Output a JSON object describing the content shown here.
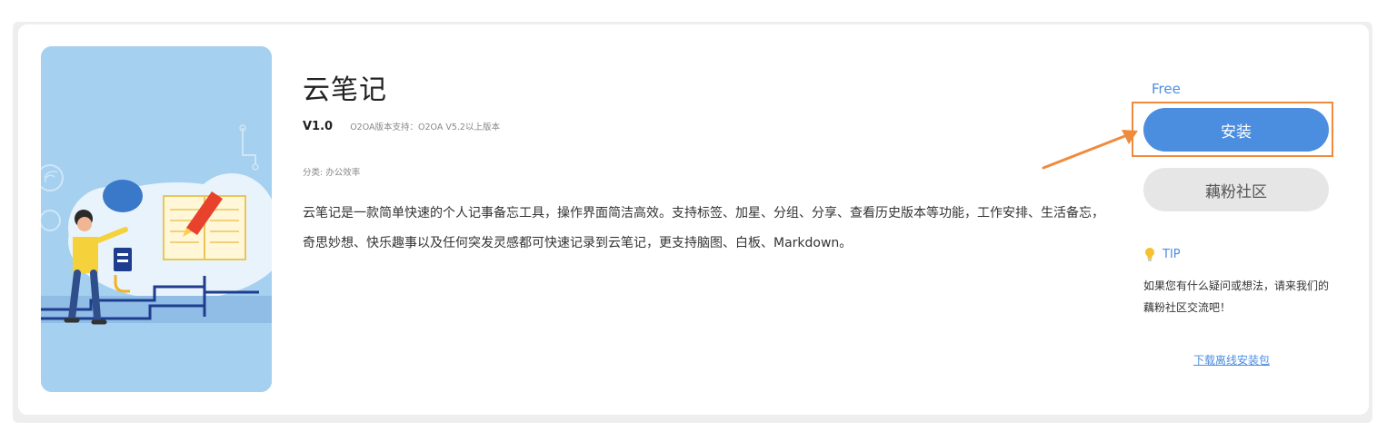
{
  "app": {
    "title": "云笔记",
    "version": "V1.0",
    "support": "O2OA版本支持：O2OA V5.2以上版本",
    "category": "分类: 办公效率",
    "description": "云笔记是一款简单快速的个人记事备忘工具，操作界面简洁高效。支持标签、加星、分组、分享、查看历史版本等功能，工作安排、生活备忘，奇思妙想、快乐趣事以及任何突发灵感都可快速记录到云笔记，更支持脑图、白板、Markdown。",
    "cover_icon": "notebook-illustration"
  },
  "sidebar": {
    "price": "Free",
    "install_label": "安装",
    "community_label": "藕粉社区",
    "tip_title": "TIP",
    "tip_icon": "lightbulb-icon",
    "tip_text": "如果您有什么疑问或想法，请来我们的藕粉社区交流吧！",
    "offline_link": "下载离线安装包"
  },
  "colors": {
    "accent": "#4b8ee0",
    "highlight": "#f08a3c",
    "secondary_button": "#e6e6e6"
  }
}
